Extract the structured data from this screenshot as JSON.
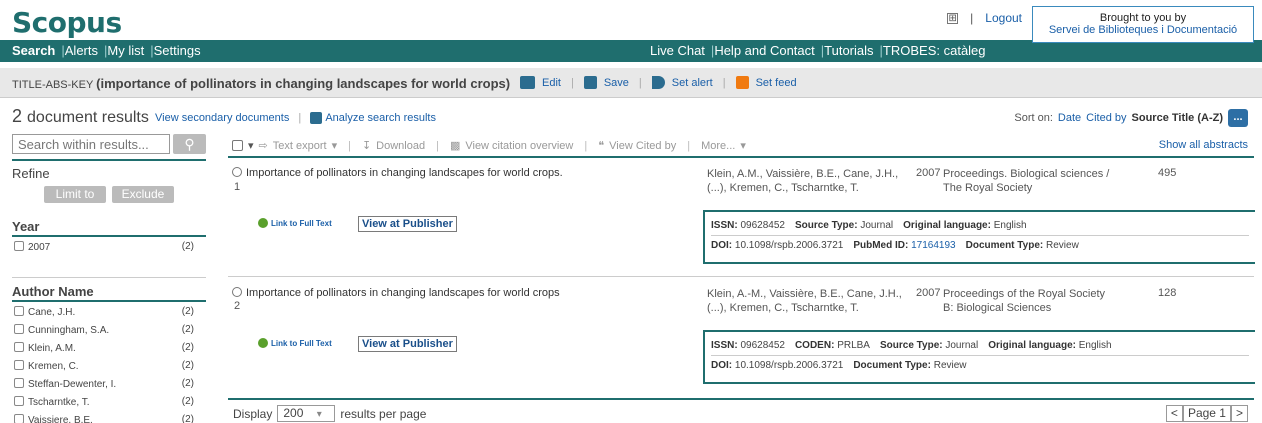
{
  "header": {
    "logo": "Scopus",
    "expand": "⊞",
    "logout": "Logout",
    "brought_line1": "Brought to you by",
    "brought_line2": "Servei de Biblioteques i Documentació"
  },
  "nav": {
    "search": "Search",
    "alerts": "Alerts",
    "mylist": "My list",
    "settings": "Settings",
    "livechat": "Live Chat",
    "help": "Help and Contact",
    "tutorials": "Tutorials",
    "trobes": "TROBES: catàleg"
  },
  "query": {
    "field": "TITLE-ABS-KEY",
    "text": "importance of pollinators in changing landscapes for world crops",
    "edit": "Edit",
    "save": "Save",
    "setalert": "Set alert",
    "setfeed": "Set feed"
  },
  "results": {
    "count": "2",
    "label": "document results",
    "secondary": "View secondary documents",
    "analyze": "Analyze search results",
    "sort_label": "Sort on:",
    "sort_date": "Date",
    "sort_cited": "Cited by",
    "sort_source": "Source Title (A-Z)",
    "sort_more": "...",
    "show_abstracts": "Show all abstracts"
  },
  "toolbar": {
    "text_export": "Text export",
    "download": "Download",
    "citation_overview": "View citation overview",
    "cited_by": "View Cited by",
    "more": "More..."
  },
  "sidebar": {
    "search_placeholder": "Search within results...",
    "refine": "Refine",
    "limit_to": "Limit to",
    "exclude": "Exclude",
    "year_title": "Year",
    "years": [
      {
        "label": "2007",
        "count": "(2)"
      }
    ],
    "author_title": "Author Name",
    "authors": [
      {
        "label": "Cane, J.H.",
        "count": "(2)"
      },
      {
        "label": "Cunningham, S.A.",
        "count": "(2)"
      },
      {
        "label": "Klein, A.M.",
        "count": "(2)"
      },
      {
        "label": "Kremen, C.",
        "count": "(2)"
      },
      {
        "label": "Steffan-Dewenter, I.",
        "count": "(2)"
      },
      {
        "label": "Tscharntke, T.",
        "count": "(2)"
      },
      {
        "label": "Vaissiere, B.E.",
        "count": "(2)"
      }
    ]
  },
  "rows": [
    {
      "title": "Importance of pollinators in changing landscapes for world crops.",
      "index": "1",
      "authors": "Klein, A.M., Vaissière, B.E., Cane, J.H., (...), Kremen, C., Tscharntke, T.",
      "year": "2007",
      "source": "Proceedings. Biological sciences / The Royal Society",
      "cites": "495",
      "full_text": "Link to Full Text",
      "publisher": "View at Publisher",
      "meta1": {
        "issn_label": "ISSN:",
        "issn": "09628452",
        "st_label": "Source Type:",
        "st": "Journal",
        "lang_label": "Original language:",
        "lang": "English"
      },
      "meta2": {
        "doi_label": "DOI:",
        "doi": "10.1098/rspb.2006.3721",
        "pm_label": "PubMed ID:",
        "pm": "17164193",
        "dt_label": "Document Type:",
        "dt": "Review"
      }
    },
    {
      "title": "Importance of pollinators in changing landscapes for world crops",
      "index": "2",
      "authors": "Klein, A.-M., Vaissière, B.E., Cane, J.H., (...), Kremen, C., Tscharntke, T.",
      "year": "2007",
      "source": "Proceedings of the Royal Society B: Biological Sciences",
      "cites": "128",
      "full_text": "Link to Full Text",
      "publisher": "View at Publisher",
      "meta1": {
        "issn_label": "ISSN:",
        "issn": "09628452",
        "coden_label": "CODEN:",
        "coden": "PRLBA",
        "st_label": "Source Type:",
        "st": "Journal",
        "lang_label": "Original language:",
        "lang": "English"
      },
      "meta2": {
        "doi_label": "DOI:",
        "doi": "10.1098/rspb.2006.3721",
        "dt_label": "Document Type:",
        "dt": "Review"
      }
    }
  ],
  "footer": {
    "display": "Display",
    "per_page": "200",
    "per_page_suffix": "results per page",
    "prev": "<",
    "page": "Page 1",
    "next": ">"
  }
}
